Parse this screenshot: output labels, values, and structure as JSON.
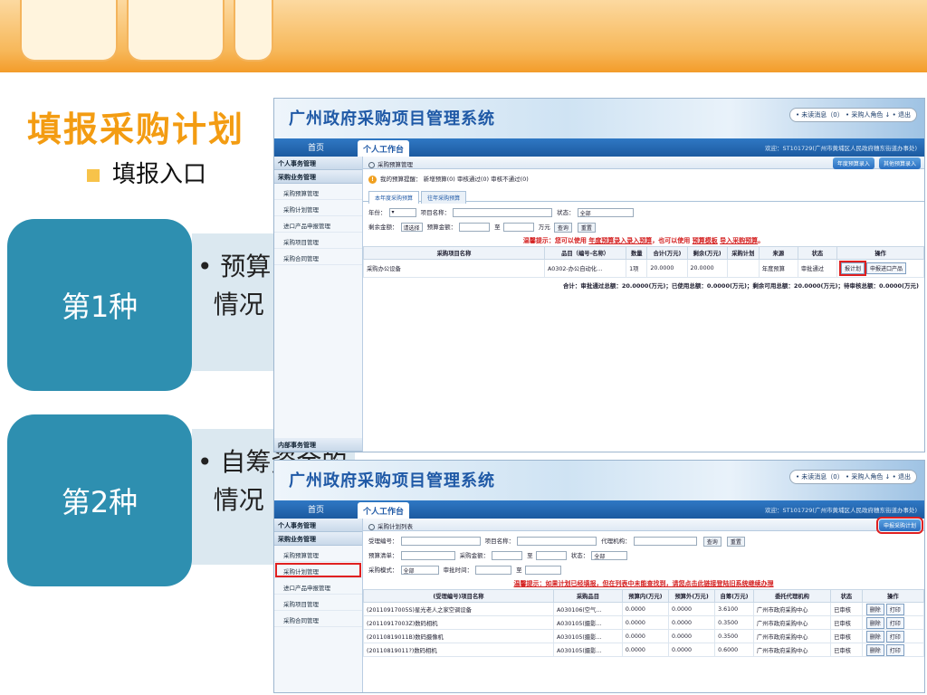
{
  "slide": {
    "title": "填报采购计划",
    "entry_bullet": "填报入口",
    "method1": {
      "label": "第1种",
      "text": "• 预算\n  情况"
    },
    "method2": {
      "label": "第2种",
      "text": "• 自筹资金的\n  情况"
    }
  },
  "app": {
    "title": "广州政府采购项目管理系统",
    "top_links": "• 未读消息（0）   • 采购人角色 ↓   • 退出",
    "nav_home": "首页",
    "nav_work": "个人工作台",
    "welcome": "欢迎：ST101729(广州市黄埔区人民政府穗东街道办事处)"
  },
  "sidebar": {
    "personal": "个人事务管理",
    "business": "采购业务管理",
    "items": [
      "采购预算管理",
      "采购计划管理",
      "进口产品申报管理",
      "采购项目管理",
      "采购合同管理"
    ],
    "internal": "内部事务管理"
  },
  "win1": {
    "panel_title": "采购预算管理",
    "btn_annual": "年度预算录入",
    "btn_other": "其他预算录入",
    "reminder": "我的预算提醒：  新增预算(0)    审核通过(0)    审核不通过(0)",
    "tabs": [
      "本年度采购预算",
      "往年采购预算"
    ],
    "filter": {
      "year_label": "年份：",
      "project_label": "项目名称：",
      "status_label": "状态：",
      "status_value": "全部",
      "remain_label": "剩余金额：",
      "remain_select": "请选择",
      "budget_label": "预算金额：",
      "to": "至",
      "unit": "万元",
      "search": "查询",
      "reset": "重置"
    },
    "tip_prefix": "温馨提示：您可以使用",
    "tip_link1": "年度预算录入录入预算",
    "tip_mid": "，也可以使用",
    "tip_link2": "预算模板",
    "tip_link3": "导入采购预算",
    "tip_end": "。",
    "columns": [
      "采购项目名称",
      "品目（编号-名称）",
      "数量",
      "合计(万元)",
      "剩余(万元)",
      "采购计划",
      "来源",
      "状态",
      "操作"
    ],
    "rows": [
      {
        "name": "采购办公设备",
        "item": "A0302-办公自动化…",
        "qty": "1项",
        "total": "20.0000",
        "remain": "20.0000",
        "plan": "",
        "source": "年度预算",
        "status": "审批通过",
        "act1": "报计划",
        "act2": "申报进口产品"
      }
    ],
    "summary": "合计：审批通过总额：20.0000(万元)；已使用总额：0.0000(万元)；剩余可用总额：20.0000(万元)；待审核总额：0.0000(万元)"
  },
  "win2": {
    "panel_title": "采购计划列表",
    "btn_declare": "申报采购计划",
    "filter": {
      "accept_no": "受理编号：",
      "project": "项目名称：",
      "agency": "代理机构：",
      "search": "查询",
      "reset": "重置",
      "budget_list": "预算清单：",
      "amount": "采购金额：",
      "to": "至",
      "status": "状态：",
      "status_value": "全部",
      "mode": "采购模式：",
      "mode_value": "全部",
      "approve_time": "审批时间："
    },
    "tip": "温馨提示：如果计划已经填报，但在列表中未能查找到，请您点击此链接登陆旧系统继续办理",
    "columns": [
      "(受理编号)项目名称",
      "采购品目",
      "预算内(万元)",
      "预算外(万元)",
      "自筹(万元)",
      "委托代理机构",
      "状态",
      "操作"
    ],
    "rows": [
      {
        "name": "(20110917005S)星光老人之家空调设备",
        "item": "A030106(空气…",
        "in": "0.0000",
        "out": "0.0000",
        "self": "3.6100",
        "agency": "广州市政府采购中心",
        "status": "已审核",
        "a1": "删除",
        "a2": "打印"
      },
      {
        "name": "(20110917003Z)数码相机",
        "item": "A030105(摄影…",
        "in": "0.0000",
        "out": "0.0000",
        "self": "0.3500",
        "agency": "广州市政府采购中心",
        "status": "已审核",
        "a1": "删除",
        "a2": "打印"
      },
      {
        "name": "(20110819011B)数码摄像机",
        "item": "A030105(摄影…",
        "in": "0.0000",
        "out": "0.0000",
        "self": "0.3500",
        "agency": "广州市政府采购中心",
        "status": "已审核",
        "a1": "删除",
        "a2": "打印"
      },
      {
        "name": "(20110819011?)数码相机",
        "item": "A030105(摄影…",
        "in": "0.0000",
        "out": "0.0000",
        "self": "0.6000",
        "agency": "广州市政府采购中心",
        "status": "已审核",
        "a1": "删除",
        "a2": "打印"
      }
    ]
  },
  "colors": {
    "accent_orange": "#f39c12",
    "pill_blue": "#2e8fb0",
    "app_blue": "#1f59a6",
    "highlight_red": "#e02020"
  }
}
